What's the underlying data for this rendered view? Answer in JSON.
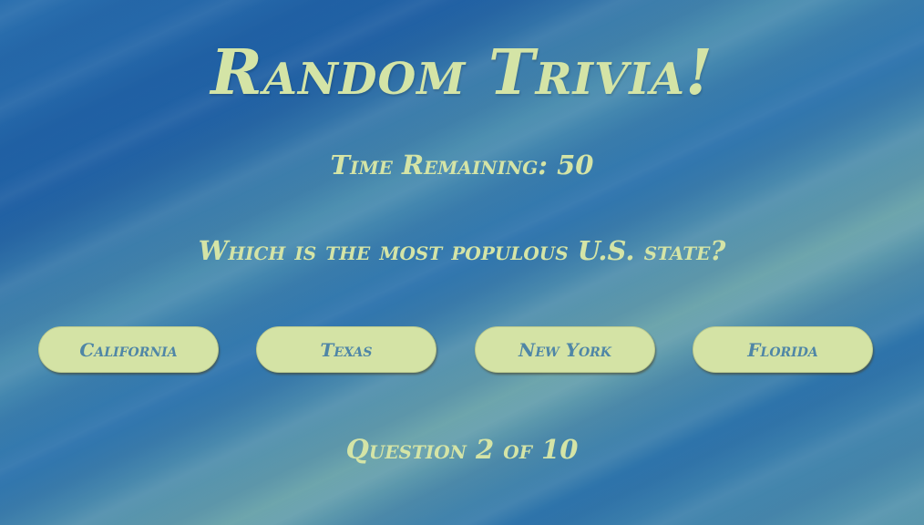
{
  "game": {
    "title": "Random Trivia!",
    "timer_text": "Time Remaining: 50",
    "question_text": "Which is the most populous U.S. state?",
    "answers": [
      {
        "label": "California"
      },
      {
        "label": "Texas"
      },
      {
        "label": "New York"
      },
      {
        "label": "Florida"
      }
    ],
    "progress_text": "Question 2 of 10"
  },
  "colors": {
    "text": "#d4e4a6",
    "button_bg": "#d4e3a5",
    "button_text": "#4f86a6",
    "background_primary": "#1f5fa3",
    "background_secondary": "#6ea6ad"
  }
}
